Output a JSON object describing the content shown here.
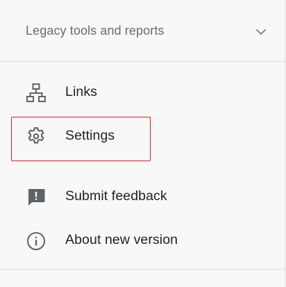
{
  "section": {
    "title": "Legacy tools and reports",
    "expand_icon": "chevron-down-icon"
  },
  "nav": {
    "items": [
      {
        "label": "Links",
        "icon": "links-icon"
      },
      {
        "label": "Settings",
        "icon": "gear-icon"
      },
      {
        "label": "Submit feedback",
        "icon": "feedback-icon"
      },
      {
        "label": "About new version",
        "icon": "info-icon"
      }
    ]
  },
  "colors": {
    "background": "#f8f8f8",
    "text": "#222222",
    "muted_text": "#6b6b6b",
    "icon": "#5f6368",
    "highlight": "#d71f1f",
    "divider": "#dcdcdc"
  }
}
